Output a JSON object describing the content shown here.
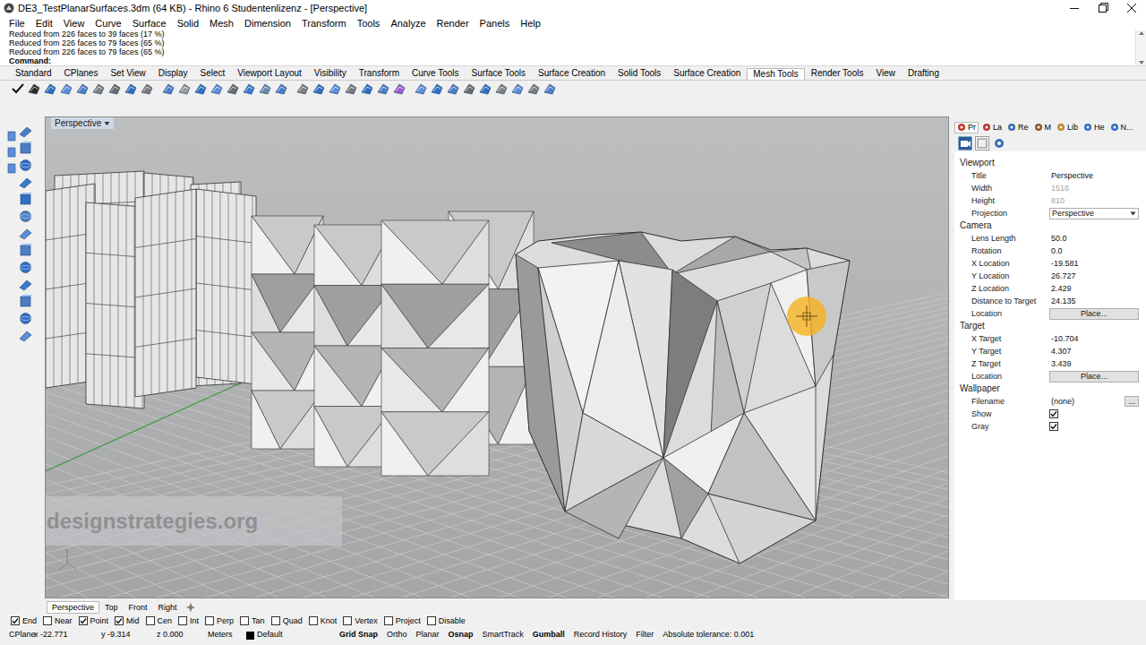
{
  "window": {
    "title": "DE3_TestPlanarSurfaces.3dm (64 KB) - Rhino 6 Studentenlizenz - [Perspective]"
  },
  "menu": [
    "File",
    "Edit",
    "View",
    "Curve",
    "Surface",
    "Solid",
    "Mesh",
    "Dimension",
    "Transform",
    "Tools",
    "Analyze",
    "Render",
    "Panels",
    "Help"
  ],
  "command_history": [
    "Reduced from 226 faces to 39 faces (17 %)",
    "Reduced from 226 faces to 79 faces (65 %)",
    "Reduced from 226 faces to 79 faces (65 %)"
  ],
  "command_prompt": "Command:",
  "toolbar_tabs": [
    {
      "label": "Standard",
      "selected": false
    },
    {
      "label": "CPlanes",
      "selected": false
    },
    {
      "label": "Set View",
      "selected": false
    },
    {
      "label": "Display",
      "selected": false
    },
    {
      "label": "Select",
      "selected": false
    },
    {
      "label": "Viewport Layout",
      "selected": false
    },
    {
      "label": "Visibility",
      "selected": false
    },
    {
      "label": "Transform",
      "selected": false
    },
    {
      "label": "Curve Tools",
      "selected": false
    },
    {
      "label": "Surface Tools",
      "selected": false
    },
    {
      "label": "Surface Creation",
      "selected": false
    },
    {
      "label": "Solid Tools",
      "selected": false
    },
    {
      "label": "Surface Creation",
      "selected": false
    },
    {
      "label": "Mesh Tools",
      "selected": true
    },
    {
      "label": "Render Tools",
      "selected": false
    },
    {
      "label": "View",
      "selected": false
    },
    {
      "label": "Drafting",
      "selected": false
    }
  ],
  "viewport": {
    "title": "Perspective",
    "watermark": "designstrategies.org"
  },
  "viewport_tabs": [
    {
      "label": "Perspective",
      "selected": true
    },
    {
      "label": "Top",
      "selected": false
    },
    {
      "label": "Front",
      "selected": false
    },
    {
      "label": "Right",
      "selected": false
    }
  ],
  "osnaps": [
    {
      "label": "End",
      "checked": true
    },
    {
      "label": "Near",
      "checked": false
    },
    {
      "label": "Point",
      "checked": true
    },
    {
      "label": "Mid",
      "checked": true
    },
    {
      "label": "Cen",
      "checked": false
    },
    {
      "label": "Int",
      "checked": false
    },
    {
      "label": "Perp",
      "checked": false
    },
    {
      "label": "Tan",
      "checked": false
    },
    {
      "label": "Quad",
      "checked": false
    },
    {
      "label": "Knot",
      "checked": false
    },
    {
      "label": "Vertex",
      "checked": false
    },
    {
      "label": "Project",
      "checked": false
    },
    {
      "label": "Disable",
      "checked": false
    }
  ],
  "status_bar": {
    "cplane": "CPlane",
    "x": "x -22.771",
    "y": "y -9.314",
    "z": "z 0.000",
    "units": "Meters",
    "layer": {
      "label": "Default",
      "color": "#000000"
    },
    "toggles": [
      {
        "label": "Grid Snap",
        "on": true
      },
      {
        "label": "Ortho",
        "on": false
      },
      {
        "label": "Planar",
        "on": false
      },
      {
        "label": "Osnap",
        "on": true
      },
      {
        "label": "SmartTrack",
        "on": false
      },
      {
        "label": "Gumball",
        "on": true
      },
      {
        "label": "Record History",
        "on": false
      },
      {
        "label": "Filter",
        "on": false
      }
    ],
    "tolerance": "Absolute tolerance: 0.001"
  },
  "panel": {
    "tabs": [
      {
        "label": "Pr",
        "selected": true
      },
      {
        "label": "La",
        "selected": false
      },
      {
        "label": "Re",
        "selected": false
      },
      {
        "label": "M",
        "selected": false
      },
      {
        "label": "Lib",
        "selected": false
      },
      {
        "label": "He",
        "selected": false
      },
      {
        "label": "N...",
        "selected": false
      }
    ],
    "sections": [
      {
        "title": "Viewport",
        "rows": [
          {
            "label": "Title",
            "kind": "text",
            "value": "Perspective",
            "disabled": false
          },
          {
            "label": "Width",
            "kind": "text",
            "value": "1516",
            "disabled": true
          },
          {
            "label": "Height",
            "kind": "text",
            "value": "810",
            "disabled": true
          },
          {
            "label": "Projection",
            "kind": "dropdown",
            "value": "Perspective",
            "disabled": false
          }
        ]
      },
      {
        "title": "Camera",
        "rows": [
          {
            "label": "Lens Length",
            "kind": "text",
            "value": "50.0",
            "disabled": false
          },
          {
            "label": "Rotation",
            "kind": "text",
            "value": "0.0",
            "disabled": false
          },
          {
            "label": "X Location",
            "kind": "text",
            "value": "-19.581",
            "disabled": false
          },
          {
            "label": "Y Location",
            "kind": "text",
            "value": "26.727",
            "disabled": false
          },
          {
            "label": "Z Location",
            "kind": "text",
            "value": "2.429",
            "disabled": false
          },
          {
            "label": "Distance to Target",
            "kind": "text",
            "value": "24.135",
            "disabled": false
          },
          {
            "label": "Location",
            "kind": "button",
            "value": "Place...",
            "disabled": false
          }
        ]
      },
      {
        "title": "Target",
        "rows": [
          {
            "label": "X Target",
            "kind": "text",
            "value": "-10.704",
            "disabled": false
          },
          {
            "label": "Y Target",
            "kind": "text",
            "value": "4.307",
            "disabled": false
          },
          {
            "label": "Z Target",
            "kind": "text",
            "value": "3.439",
            "disabled": false
          },
          {
            "label": "Location",
            "kind": "button",
            "value": "Place...",
            "disabled": false
          }
        ]
      },
      {
        "title": "Wallpaper",
        "rows": [
          {
            "label": "Filename",
            "kind": "file",
            "value": "(none)",
            "button": "...",
            "disabled": false
          },
          {
            "label": "Show",
            "kind": "checkbox",
            "checked": true,
            "disabled": false
          },
          {
            "label": "Gray",
            "kind": "checkbox",
            "checked": true,
            "disabled": false
          }
        ]
      }
    ]
  }
}
